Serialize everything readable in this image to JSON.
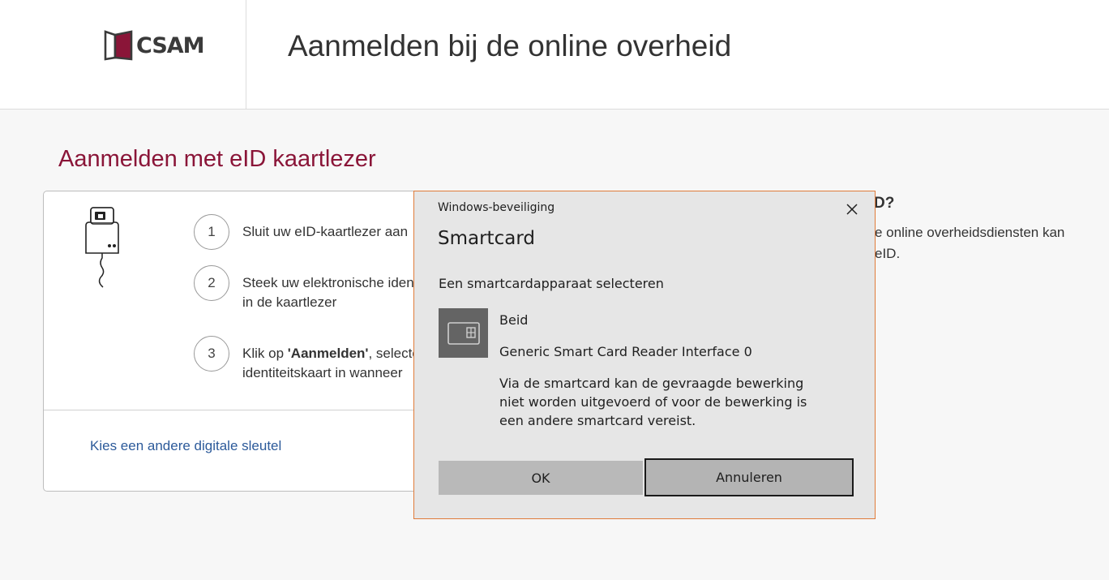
{
  "header": {
    "logo_text": "CSAM",
    "title": "Aanmelden bij de online overheid"
  },
  "main": {
    "heading": "Aanmelden met eID kaartlezer",
    "steps": [
      {
        "number": "1",
        "line1": "Sluit uw eID-kaartlezer aan"
      },
      {
        "number": "2",
        "line1": "Steek uw elektronische iden",
        "line2": "in de kaartlezer"
      },
      {
        "number": "3",
        "line1_prefix": "Klik op ",
        "line1_bold": "'Aanmelden'",
        "line1_suffix": ", selecte",
        "line2": "identiteitskaart in wanneer"
      }
    ],
    "alt_link": "Kies een andere digitale sleutel"
  },
  "right": {
    "heading": "D?",
    "text_line1": "e online overheidsdiensten kan",
    "text_line2": "eID."
  },
  "dialog": {
    "caption": "Windows-beveiliging",
    "title": "Smartcard",
    "subtitle": "Een smartcardapparaat selecteren",
    "device_name": "Beid",
    "device_reader": "Generic Smart Card Reader Interface 0",
    "device_message": "Via de smartcard kan de gevraagde bewerking niet worden uitgevoerd of voor de bewerking is een andere smartcard vereist.",
    "ok_label": "OK",
    "cancel_label": "Annuleren"
  },
  "colors": {
    "accent": "#8a1538",
    "link": "#2c5a9a",
    "dialog_border": "#e07b3a",
    "dialog_bg": "#e6e6e6"
  },
  "icons": [
    "csam-logo-icon",
    "card-reader-icon",
    "close-icon",
    "smartcard-icon"
  ]
}
